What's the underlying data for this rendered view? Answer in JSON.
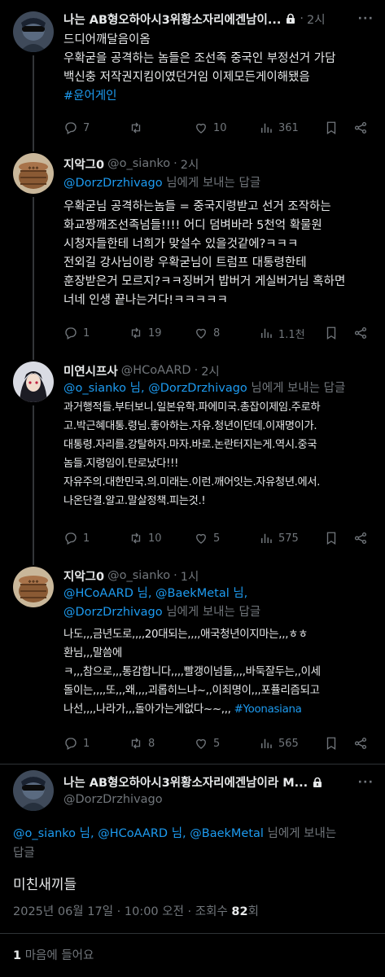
{
  "tweets": [
    {
      "name": "나는 AB형오하아시3위황소자리에겐남이...",
      "handle": "",
      "time": "2시",
      "lines": [
        "드디어깨달음이옴",
        "우확굳을 공격하는 놈들은 조선족 중국인 부정선거 가담",
        "백신충 저작권지킴이였던거임 이제모든게이해됐음",
        "#윤어게인"
      ],
      "replies": "7",
      "retweets": "",
      "likes": "10",
      "views": "361"
    },
    {
      "name": "지악그0",
      "handle": "@o_sianko",
      "time": "2시",
      "reply_mentions": "@DorzDrzhivago",
      "reply_suffix": " 님에게 보내는 답글",
      "lines": [
        "우확굳님 공격하는놈들 = 중국지령받고 선거 조작하는",
        "화교짱깨조선족넘들!!!! 어디 덤벼바라 5천억 확물원",
        "시청자들한테 너희가 맞설수 있을것같에?ㅋㅋㅋ",
        "전외길 강사님이랑 우확굳님이 트럼프 대통령한테",
        "훈장받은거 모르지?ㅋㅋ징버거 밥버거 게실버거님 혹하면",
        "너네 인생 끝나는거다!ㅋㅋㅋㅋㅋ"
      ],
      "replies": "1",
      "retweets": "19",
      "likes": "8",
      "views": "1.1천"
    },
    {
      "name": "미연시프사",
      "handle": "@HCoAARD",
      "time": "2시",
      "reply_mentions": "@o_sianko 님, @DorzDrzhivago",
      "reply_suffix": " 님에게 보내는 답글",
      "lines": [
        "과거행적들.부터보니.일본유학.파에미국.총잡이제임.주로하",
        "고.박근혜대통.령님.좋아하는.자유.청년이던데.이재명이가.",
        "대통령.자리를.강탈하자.마자.바로.논란터지는게.역시.중국",
        "놈들.지령임이.탄로났다!!!",
        "자유주의.대한민국.의.미래는.이런.깨어잇는.자유청년.에서.",
        "나온단결.알고.말살정책.피는것.!"
      ],
      "replies": "1",
      "retweets": "10",
      "likes": "5",
      "views": "575"
    },
    {
      "name": "지악그0",
      "handle": "@o_sianko",
      "time": "1시",
      "reply_line1": "@HCoAARD 님, @BaekMetal 님,",
      "reply_mentions": "@DorzDrzhivago",
      "reply_suffix": " 님에게 보내는 답글",
      "lines": [
        "나도,,,금년도로,,,,20대되는,,,,애국청년이지마는,,,ㅎㅎ",
        "환님,,,말씀에",
        "ㅋ,,,참으로,,,통감합니다,,,,빨갱이넘들,,,,바둑잘두는,,이세",
        "돌이는,,,,또,,,왜,,,,괴롭히느냐~,,이죄명이,,,포퓰리즘되고"
      ],
      "last_line_text": "나선,,,,나라가,,,돌아가는게없다~~,,, ",
      "last_line_tag": "#Yoonasiana",
      "replies": "1",
      "retweets": "8",
      "likes": "5",
      "views": "565"
    }
  ],
  "main": {
    "name": "나는 AB형오하아시3위황소자리에겐남이라 M...",
    "handle": "@DorzDrzhivago",
    "reply_line1_mentions": "@o_sianko 님, @HCoAARD 님, @BaekMetal",
    "reply_line1_suffix": " 님에게 보내는",
    "reply_line2": "답글",
    "text": "미친새끼들",
    "meta_prefix": "2025년 06월 17일 · 10:00 오전 · 조회수 ",
    "views": "82",
    "meta_suffix": "회",
    "likes_count": "1",
    "likes_label": " 마음에 들어요"
  },
  "more_label": "···",
  "colors": {
    "background": "#000000",
    "link": "#1d9bf0",
    "muted": "#71767b",
    "text": "#e7e9ea"
  }
}
